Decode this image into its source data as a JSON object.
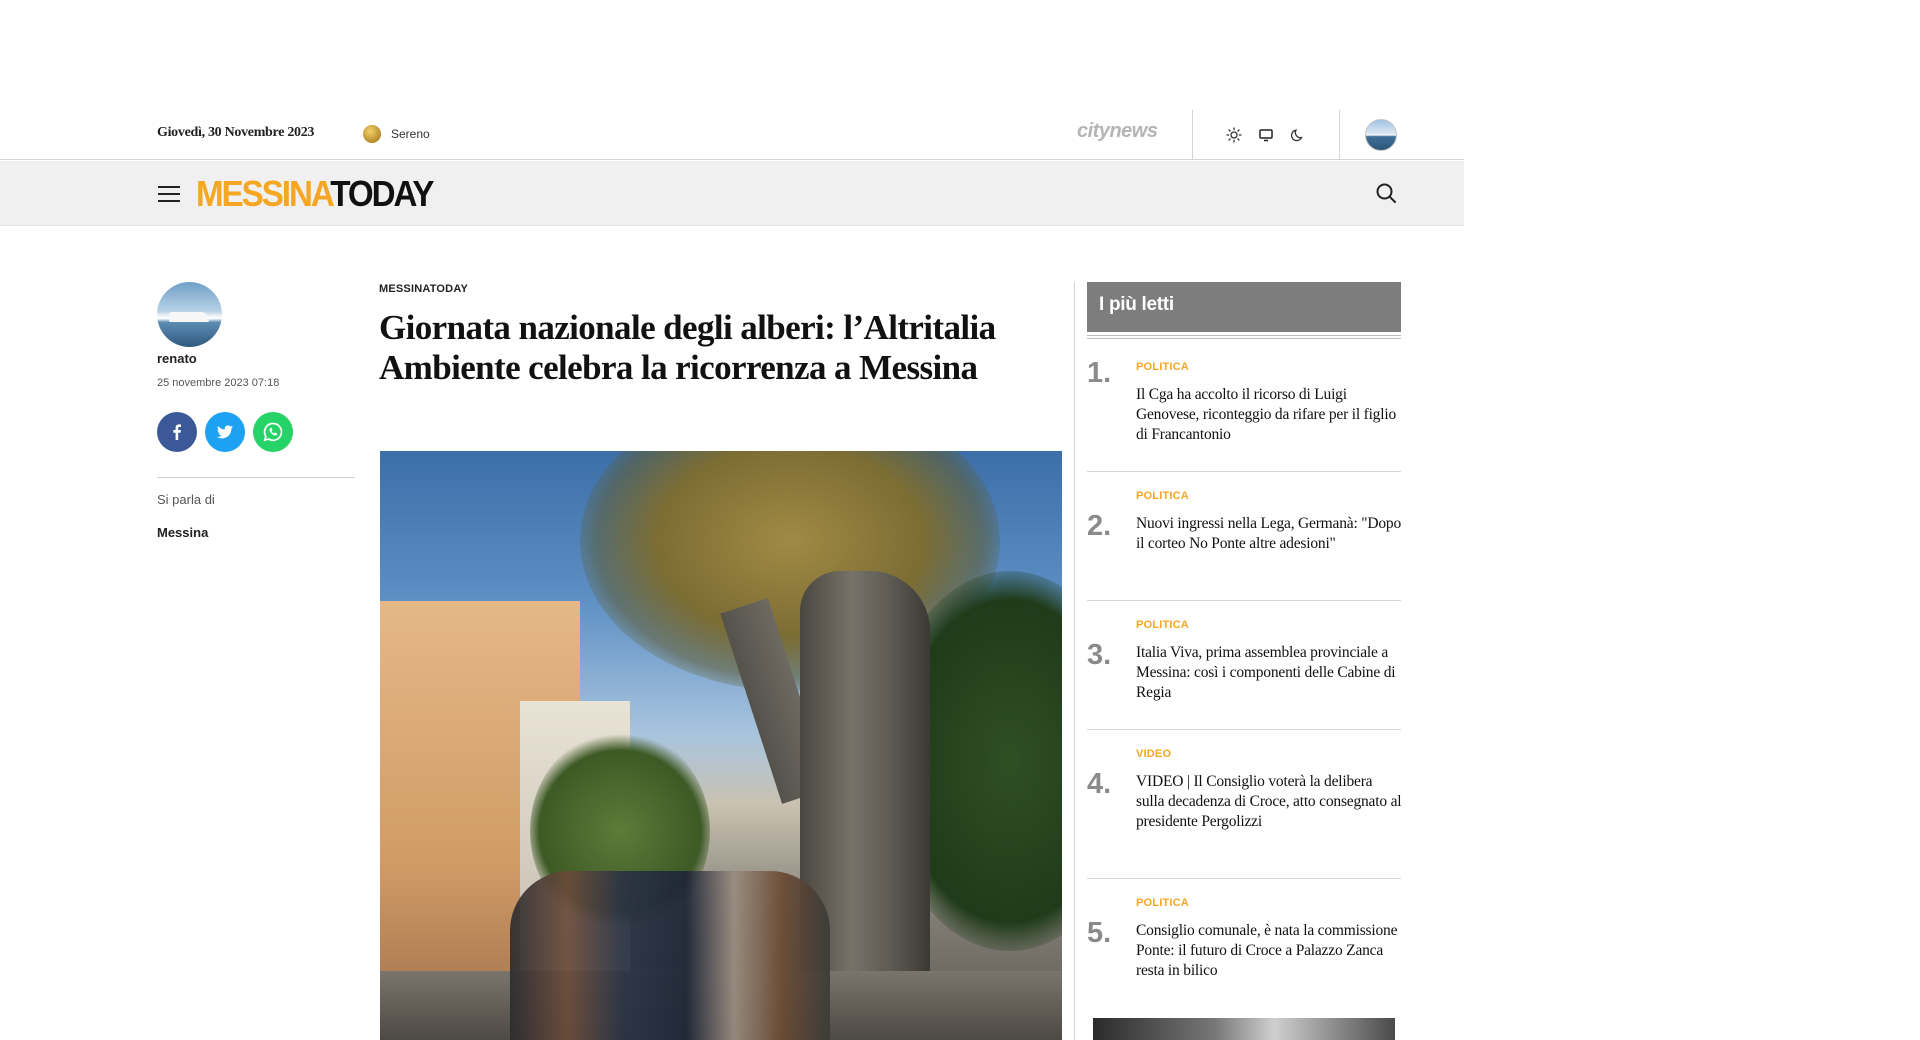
{
  "topbar": {
    "date": "Giovedì, 30 Novembre 2023",
    "weather_label": "Sereno",
    "network_logo": "citynews",
    "theme_icons": [
      "sun-icon",
      "monitor-icon",
      "moon-icon"
    ]
  },
  "masthead": {
    "logo_part1": "MESSINA",
    "logo_part2": "TODAY",
    "logo_color_primary": "#f5a623",
    "logo_color_secondary": "#111111"
  },
  "author": {
    "name": "renato",
    "date": "25 novembre 2023 07:18"
  },
  "share": [
    "facebook",
    "twitter",
    "whatsapp"
  ],
  "tags": {
    "label": "Si parla di",
    "items": [
      "Messina"
    ]
  },
  "article": {
    "kicker": "MESSINATODAY",
    "headline": "Giornata nazionale degli alberi: l’Altritalia Ambiente celebra la ricorrenza a Messina"
  },
  "sidebar": {
    "heading": "I più letti",
    "accent_color": "#f5a623",
    "items": [
      {
        "num": "1.",
        "category": "POLITICA",
        "title": "Il Cga ha accolto il ricorso di Luigi Genovese, riconteggio da rifare per il figlio di Francantonio"
      },
      {
        "num": "2.",
        "category": "POLITICA",
        "title": "Nuovi ingressi nella Lega, Germanà: \"Dopo il corteo No Ponte altre adesioni\""
      },
      {
        "num": "3.",
        "category": "POLITICA",
        "title": "Italia Viva, prima assemblea provinciale a Messina: così i componenti delle Cabine di Regia"
      },
      {
        "num": "4.",
        "category": "VIDEO",
        "title": "VIDEO | Il Consiglio voterà la delibera sulla decadenza di Croce, atto consegnato al presidente Pergolizzi"
      },
      {
        "num": "5.",
        "category": "POLITICA",
        "title": "Consiglio comunale, è nata la commissione Ponte: il futuro di Croce a Palazzo Zanca resta in bilico"
      }
    ]
  }
}
